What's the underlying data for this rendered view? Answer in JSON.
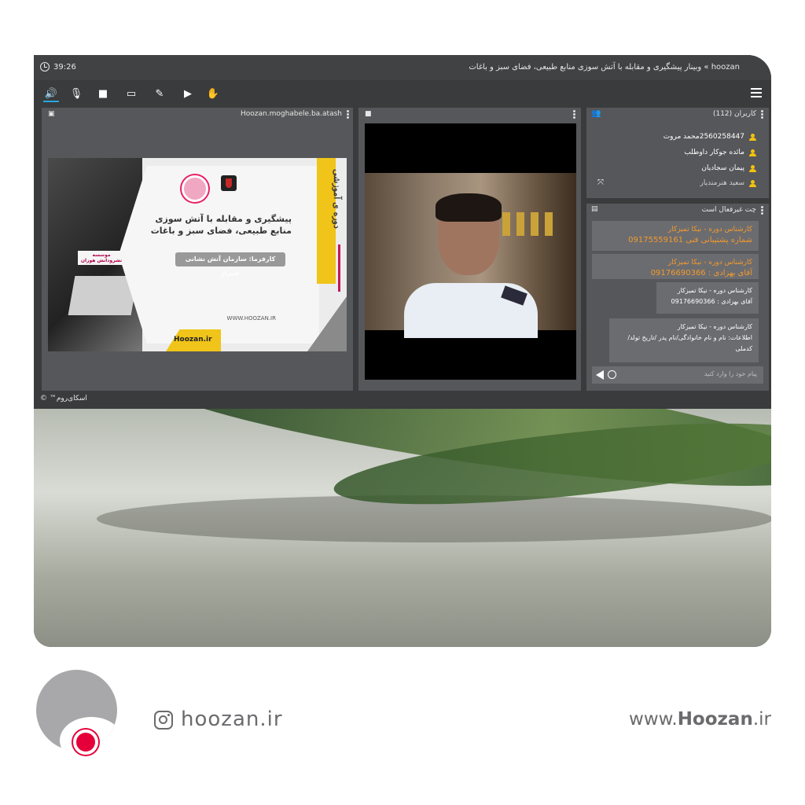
{
  "topbar": {
    "timer": "39:26",
    "title": "hoozan » وبینار پیشگیری و مقابله با آتش سوزی منابع طبیعی، فضای سبز و باغات"
  },
  "toolbar": {
    "items": [
      "speaker-icon",
      "mic-off-icon",
      "camera-icon",
      "screen-share-icon",
      "brush-icon",
      "play-icon",
      "hand-icon"
    ],
    "menu": "menu-icon"
  },
  "presentation": {
    "file": "Hoozan.moghabele.ba.atash",
    "slide": {
      "vertical": "دوره ی آموزشی",
      "heading_line1": "پیشگیری و مقابله با آتش سوزی",
      "heading_line2": "منابع طبیعی، فضای سبز و باغات",
      "client": "کارفرما: سازمان آتش نشانی شیراز",
      "web": "WWW.HOOZAN.IR",
      "instagram": "Hoozan.ir",
      "institute": "موسسه نشرودانش هوزان"
    }
  },
  "users": {
    "header": "کاربران (112)",
    "list": [
      "2560258447محمد مروت",
      "مائده جوکار داوطلب",
      "پیمان سجادیان",
      "سعید هنرمندیار"
    ]
  },
  "chat": {
    "header": "چت غیرفعال است",
    "messages": [
      {
        "line1": "کارشناس دوره - نیکا تمیزکار",
        "line2": "شماره پشتیبانی فنی 09175559161"
      },
      {
        "line1": "کارشناس دوره - نیکا تمیزکار",
        "line2": "آقای بهزادی : 09176690366"
      },
      {
        "line1": "کارشناس دوره - نیکا تمیزکار",
        "line2": "آقای بهزادی : 09176690366"
      },
      {
        "line1": "کارشناس دوره - نیکا تمیزکار",
        "line2": "اطلاعات: نام و نام خانوادگی/نام پدر /تاریخ تولد/ کدملی"
      }
    ],
    "placeholder": "پیام خود را وارد کنید"
  },
  "brand": "اسکای‌روم™ ©",
  "footer": {
    "instagram": "hoozan.ir",
    "website_prefix": "www.",
    "website_bold": "Hoozan",
    "website_suffix": ".ir"
  },
  "colors": {
    "accent": "#29a7e0",
    "orange": "#f29a2e",
    "user_icon": "#f4c20d",
    "logo_red": "#e6003a"
  }
}
